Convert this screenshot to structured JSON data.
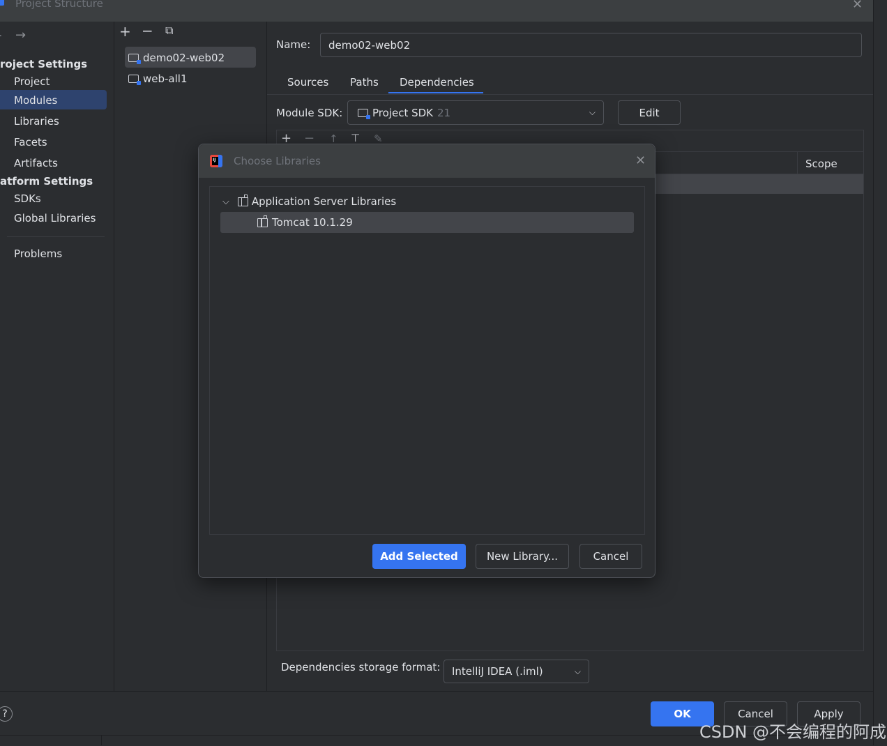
{
  "window": {
    "title": "Project Structure"
  },
  "sidebar": {
    "project_settings_header": "roject Settings",
    "platform_settings_header": "atform Settings",
    "items": [
      {
        "label": "Project"
      },
      {
        "label": "Modules",
        "selected": true
      },
      {
        "label": "Libraries"
      },
      {
        "label": "Facets"
      },
      {
        "label": "Artifacts"
      },
      {
        "label": "SDKs"
      },
      {
        "label": "Global Libraries"
      },
      {
        "label": "Problems"
      }
    ]
  },
  "modules": {
    "items": [
      {
        "label": "demo02-web02",
        "selected": true
      },
      {
        "label": "web-all1"
      }
    ]
  },
  "detail": {
    "name_label": "Name:",
    "name_value": "demo02-web02",
    "tabs": [
      {
        "label": "Sources"
      },
      {
        "label": "Paths"
      },
      {
        "label": "Dependencies",
        "active": true
      }
    ],
    "module_sdk_label": "Module SDK:",
    "sdk_value": "Project SDK",
    "sdk_version": "21",
    "edit_label": "Edit",
    "scope_header": "Scope",
    "storage_format_label": "Dependencies storage format:",
    "storage_format_value": "IntelliJ IDEA (.iml)"
  },
  "dialog": {
    "title": "Choose Libraries",
    "tree": {
      "group_label": "Application Server Libraries",
      "item_label": "Tomcat 10.1.29"
    },
    "add_selected_label": "Add Selected",
    "new_library_label": "New Library...",
    "cancel_label": "Cancel"
  },
  "footer": {
    "help_label": "?",
    "ok_label": "OK",
    "cancel_label": "Cancel",
    "apply_label": "Apply"
  },
  "watermark": "CSDN @不会编程的阿成",
  "colors": {
    "background": "#2b2d30",
    "accent": "#3574f0",
    "selection": "#2e436e"
  }
}
